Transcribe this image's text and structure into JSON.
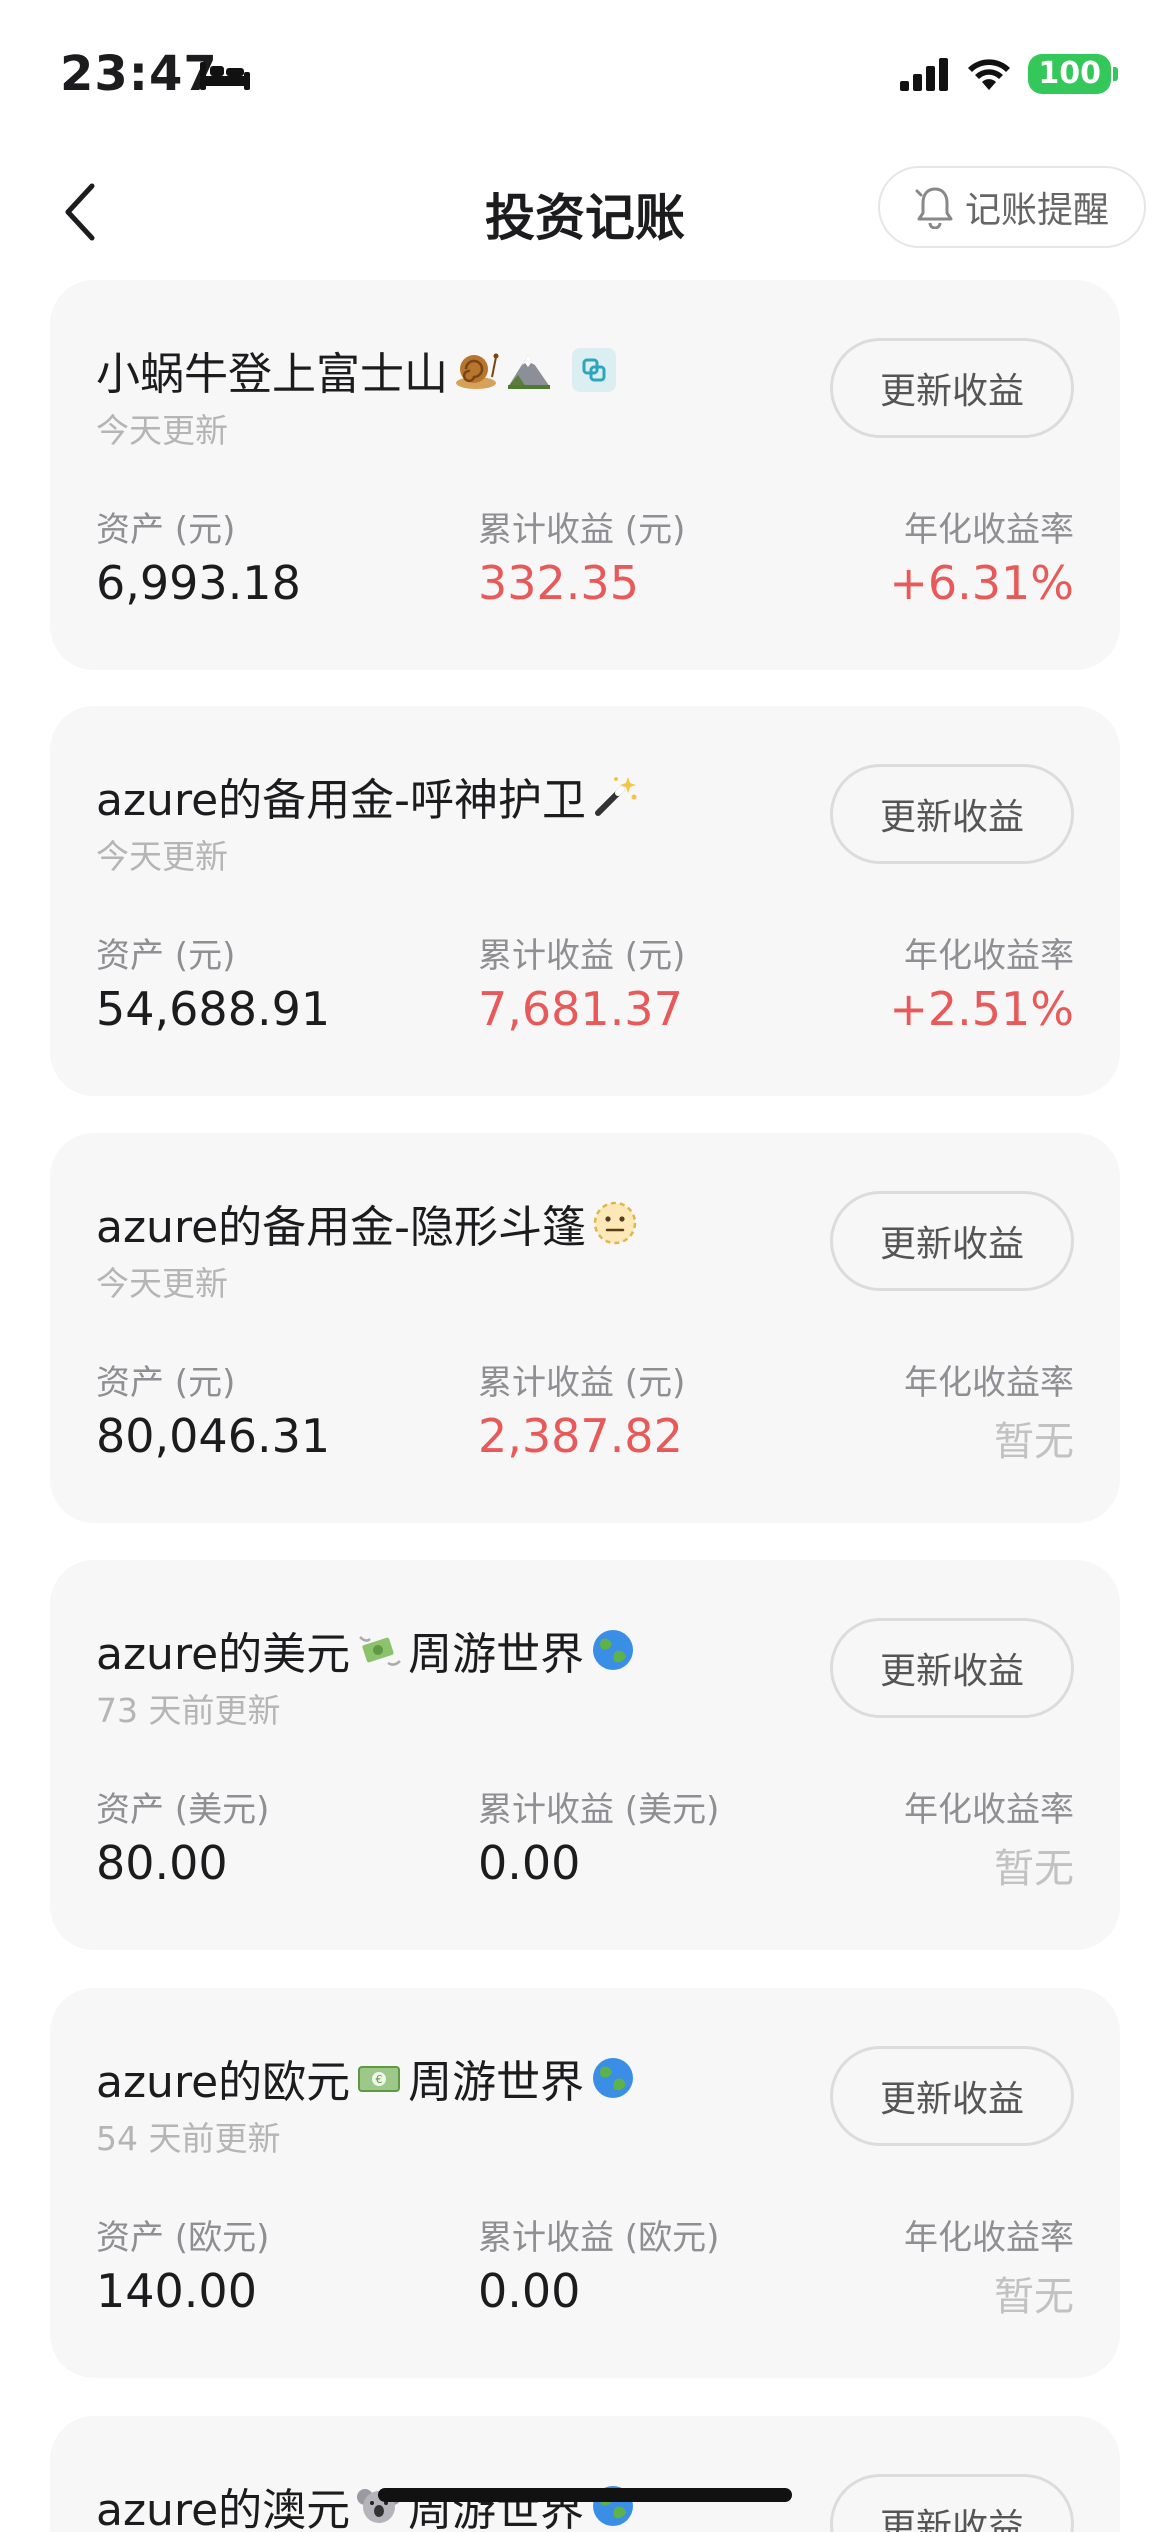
{
  "status_bar": {
    "time": "23:47",
    "battery": "100"
  },
  "nav": {
    "title": "投资记账",
    "reminder_label": "记账提醒"
  },
  "accounts": [
    {
      "name": "小蜗牛登上富士山",
      "updated": "今天更新",
      "button": "更新收益",
      "asset_label": "资产 (元)",
      "asset_value": "6,993.18",
      "profit_label": "累计收益 (元)",
      "profit_value": "332.35",
      "rate_label": "年化收益率",
      "rate_value": "+6.31%"
    },
    {
      "name": "azure的备用金-呼神护卫",
      "updated": "今天更新",
      "button": "更新收益",
      "asset_label": "资产 (元)",
      "asset_value": "54,688.91",
      "profit_label": "累计收益 (元)",
      "profit_value": "7,681.37",
      "rate_label": "年化收益率",
      "rate_value": "+2.51%"
    },
    {
      "name": "azure的备用金-隐形斗篷",
      "updated": "今天更新",
      "button": "更新收益",
      "asset_label": "资产 (元)",
      "asset_value": "80,046.31",
      "profit_label": "累计收益 (元)",
      "profit_value": "2,387.82",
      "rate_label": "年化收益率",
      "rate_value": "暂无"
    },
    {
      "name_a": "azure的美元",
      "name_b": "周游世界",
      "updated": "73 天前更新",
      "button": "更新收益",
      "asset_label": "资产 (美元)",
      "asset_value": "80.00",
      "profit_label": "累计收益 (美元)",
      "profit_value": "0.00",
      "rate_label": "年化收益率",
      "rate_value": "暂无"
    },
    {
      "name_a": "azure的欧元",
      "name_b": "周游世界",
      "updated": "54 天前更新",
      "button": "更新收益",
      "asset_label": "资产 (欧元)",
      "asset_value": "140.00",
      "profit_label": "累计收益 (欧元)",
      "profit_value": "0.00",
      "rate_label": "年化收益率",
      "rate_value": "暂无"
    },
    {
      "name_a": "azure的澳元",
      "name_b": "周游世界",
      "button": "更新收益"
    }
  ],
  "colors": {
    "profit_red": "#e85a5a",
    "card_bg": "#f7f7f7",
    "battery_green": "#34c759"
  },
  "icons": [
    "back-chevron-icon",
    "bell-icon",
    "snail-emoji",
    "mountain-emoji",
    "link-icon",
    "magic-wand-emoji",
    "neutral-face-emoji",
    "money-wings-emoji",
    "globe-emoji",
    "euro-banknote-emoji",
    "koala-emoji"
  ]
}
